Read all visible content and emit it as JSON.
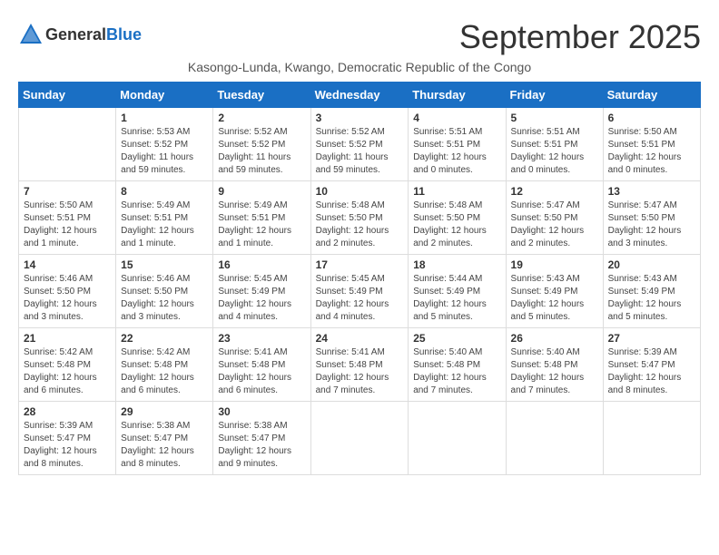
{
  "header": {
    "logo_general": "General",
    "logo_blue": "Blue",
    "month_title": "September 2025",
    "subtitle": "Kasongo-Lunda, Kwango, Democratic Republic of the Congo"
  },
  "days_of_week": [
    "Sunday",
    "Monday",
    "Tuesday",
    "Wednesday",
    "Thursday",
    "Friday",
    "Saturday"
  ],
  "weeks": [
    [
      {
        "day": "",
        "sunrise": "",
        "sunset": "",
        "daylight": ""
      },
      {
        "day": "1",
        "sunrise": "Sunrise: 5:53 AM",
        "sunset": "Sunset: 5:52 PM",
        "daylight": "Daylight: 11 hours and 59 minutes."
      },
      {
        "day": "2",
        "sunrise": "Sunrise: 5:52 AM",
        "sunset": "Sunset: 5:52 PM",
        "daylight": "Daylight: 11 hours and 59 minutes."
      },
      {
        "day": "3",
        "sunrise": "Sunrise: 5:52 AM",
        "sunset": "Sunset: 5:52 PM",
        "daylight": "Daylight: 11 hours and 59 minutes."
      },
      {
        "day": "4",
        "sunrise": "Sunrise: 5:51 AM",
        "sunset": "Sunset: 5:51 PM",
        "daylight": "Daylight: 12 hours and 0 minutes."
      },
      {
        "day": "5",
        "sunrise": "Sunrise: 5:51 AM",
        "sunset": "Sunset: 5:51 PM",
        "daylight": "Daylight: 12 hours and 0 minutes."
      },
      {
        "day": "6",
        "sunrise": "Sunrise: 5:50 AM",
        "sunset": "Sunset: 5:51 PM",
        "daylight": "Daylight: 12 hours and 0 minutes."
      }
    ],
    [
      {
        "day": "7",
        "sunrise": "Sunrise: 5:50 AM",
        "sunset": "Sunset: 5:51 PM",
        "daylight": "Daylight: 12 hours and 1 minute."
      },
      {
        "day": "8",
        "sunrise": "Sunrise: 5:49 AM",
        "sunset": "Sunset: 5:51 PM",
        "daylight": "Daylight: 12 hours and 1 minute."
      },
      {
        "day": "9",
        "sunrise": "Sunrise: 5:49 AM",
        "sunset": "Sunset: 5:51 PM",
        "daylight": "Daylight: 12 hours and 1 minute."
      },
      {
        "day": "10",
        "sunrise": "Sunrise: 5:48 AM",
        "sunset": "Sunset: 5:50 PM",
        "daylight": "Daylight: 12 hours and 2 minutes."
      },
      {
        "day": "11",
        "sunrise": "Sunrise: 5:48 AM",
        "sunset": "Sunset: 5:50 PM",
        "daylight": "Daylight: 12 hours and 2 minutes."
      },
      {
        "day": "12",
        "sunrise": "Sunrise: 5:47 AM",
        "sunset": "Sunset: 5:50 PM",
        "daylight": "Daylight: 12 hours and 2 minutes."
      },
      {
        "day": "13",
        "sunrise": "Sunrise: 5:47 AM",
        "sunset": "Sunset: 5:50 PM",
        "daylight": "Daylight: 12 hours and 3 minutes."
      }
    ],
    [
      {
        "day": "14",
        "sunrise": "Sunrise: 5:46 AM",
        "sunset": "Sunset: 5:50 PM",
        "daylight": "Daylight: 12 hours and 3 minutes."
      },
      {
        "day": "15",
        "sunrise": "Sunrise: 5:46 AM",
        "sunset": "Sunset: 5:50 PM",
        "daylight": "Daylight: 12 hours and 3 minutes."
      },
      {
        "day": "16",
        "sunrise": "Sunrise: 5:45 AM",
        "sunset": "Sunset: 5:49 PM",
        "daylight": "Daylight: 12 hours and 4 minutes."
      },
      {
        "day": "17",
        "sunrise": "Sunrise: 5:45 AM",
        "sunset": "Sunset: 5:49 PM",
        "daylight": "Daylight: 12 hours and 4 minutes."
      },
      {
        "day": "18",
        "sunrise": "Sunrise: 5:44 AM",
        "sunset": "Sunset: 5:49 PM",
        "daylight": "Daylight: 12 hours and 5 minutes."
      },
      {
        "day": "19",
        "sunrise": "Sunrise: 5:43 AM",
        "sunset": "Sunset: 5:49 PM",
        "daylight": "Daylight: 12 hours and 5 minutes."
      },
      {
        "day": "20",
        "sunrise": "Sunrise: 5:43 AM",
        "sunset": "Sunset: 5:49 PM",
        "daylight": "Daylight: 12 hours and 5 minutes."
      }
    ],
    [
      {
        "day": "21",
        "sunrise": "Sunrise: 5:42 AM",
        "sunset": "Sunset: 5:48 PM",
        "daylight": "Daylight: 12 hours and 6 minutes."
      },
      {
        "day": "22",
        "sunrise": "Sunrise: 5:42 AM",
        "sunset": "Sunset: 5:48 PM",
        "daylight": "Daylight: 12 hours and 6 minutes."
      },
      {
        "day": "23",
        "sunrise": "Sunrise: 5:41 AM",
        "sunset": "Sunset: 5:48 PM",
        "daylight": "Daylight: 12 hours and 6 minutes."
      },
      {
        "day": "24",
        "sunrise": "Sunrise: 5:41 AM",
        "sunset": "Sunset: 5:48 PM",
        "daylight": "Daylight: 12 hours and 7 minutes."
      },
      {
        "day": "25",
        "sunrise": "Sunrise: 5:40 AM",
        "sunset": "Sunset: 5:48 PM",
        "daylight": "Daylight: 12 hours and 7 minutes."
      },
      {
        "day": "26",
        "sunrise": "Sunrise: 5:40 AM",
        "sunset": "Sunset: 5:48 PM",
        "daylight": "Daylight: 12 hours and 7 minutes."
      },
      {
        "day": "27",
        "sunrise": "Sunrise: 5:39 AM",
        "sunset": "Sunset: 5:47 PM",
        "daylight": "Daylight: 12 hours and 8 minutes."
      }
    ],
    [
      {
        "day": "28",
        "sunrise": "Sunrise: 5:39 AM",
        "sunset": "Sunset: 5:47 PM",
        "daylight": "Daylight: 12 hours and 8 minutes."
      },
      {
        "day": "29",
        "sunrise": "Sunrise: 5:38 AM",
        "sunset": "Sunset: 5:47 PM",
        "daylight": "Daylight: 12 hours and 8 minutes."
      },
      {
        "day": "30",
        "sunrise": "Sunrise: 5:38 AM",
        "sunset": "Sunset: 5:47 PM",
        "daylight": "Daylight: 12 hours and 9 minutes."
      },
      {
        "day": "",
        "sunrise": "",
        "sunset": "",
        "daylight": ""
      },
      {
        "day": "",
        "sunrise": "",
        "sunset": "",
        "daylight": ""
      },
      {
        "day": "",
        "sunrise": "",
        "sunset": "",
        "daylight": ""
      },
      {
        "day": "",
        "sunrise": "",
        "sunset": "",
        "daylight": ""
      }
    ]
  ]
}
